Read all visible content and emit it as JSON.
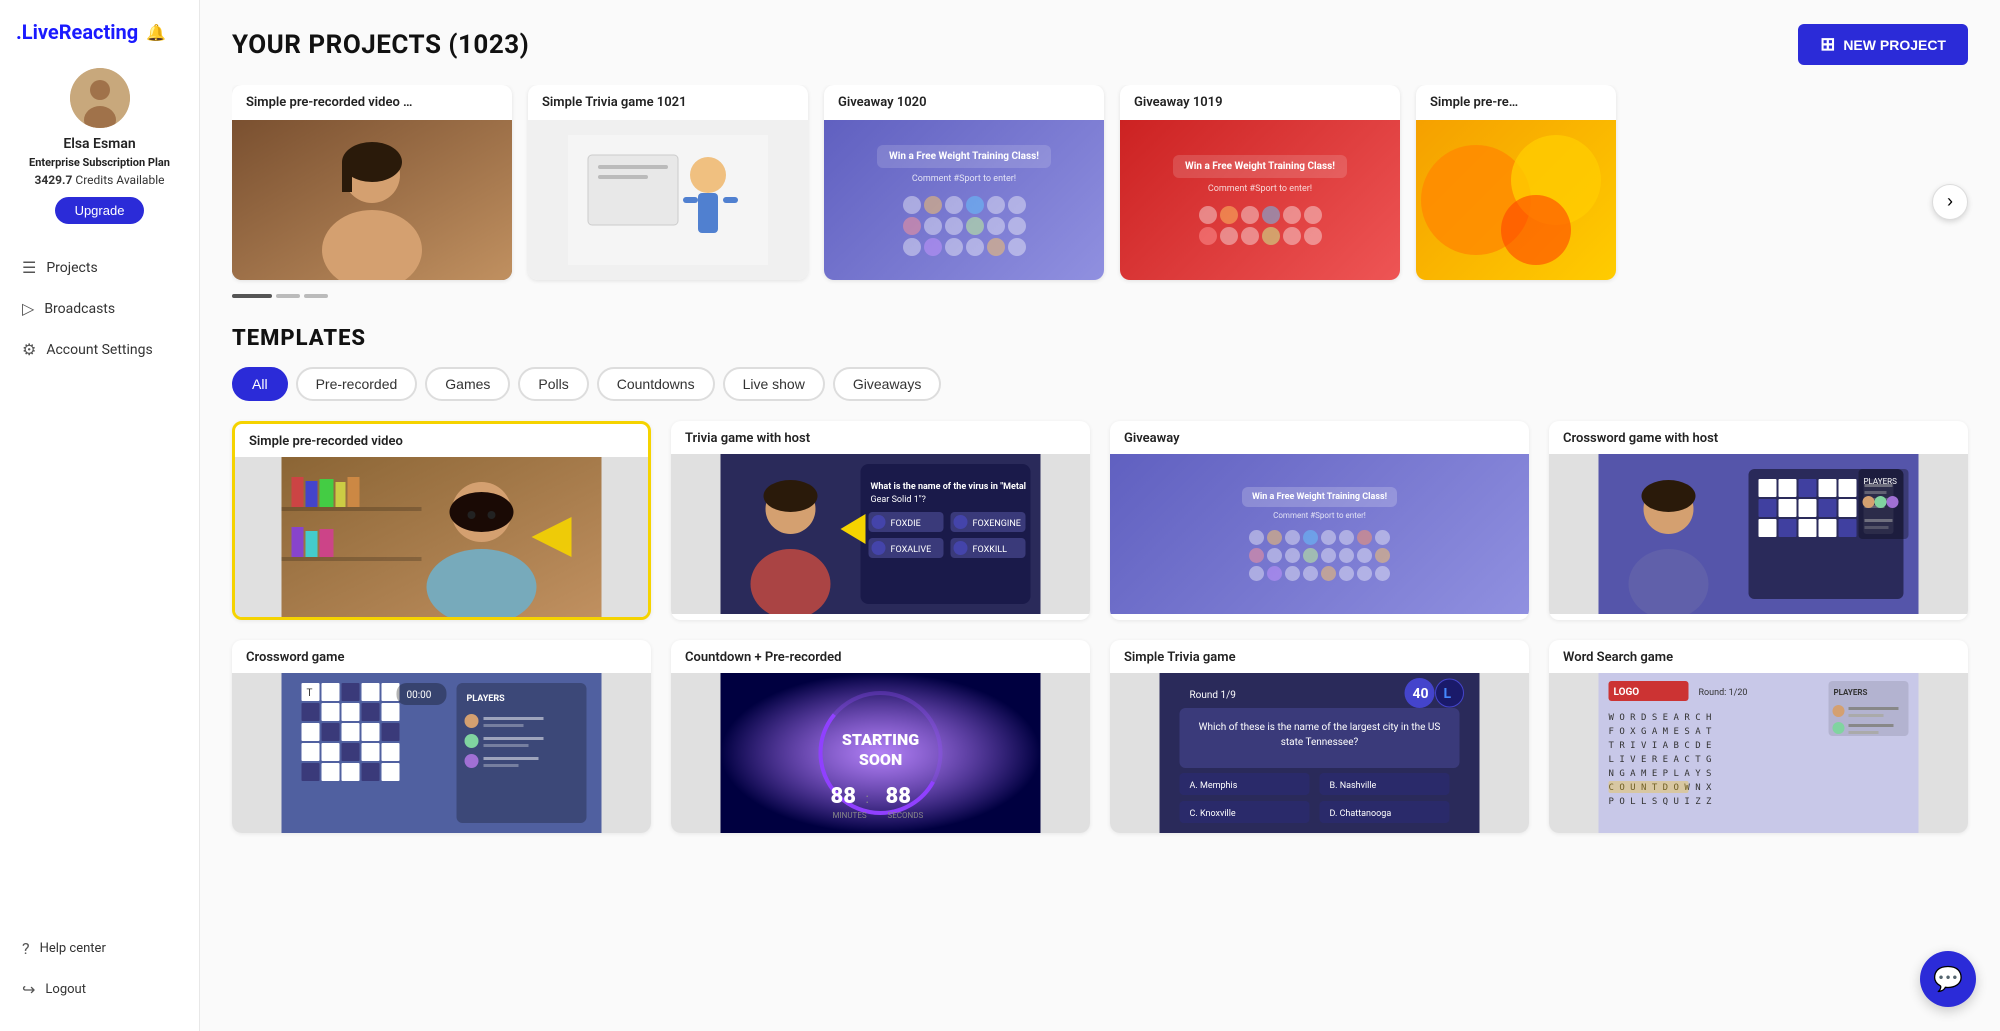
{
  "app": {
    "logo": ".LiveReacting",
    "notification_icon": "🔔"
  },
  "user": {
    "name": "Elsa Esman",
    "plan_type": "Enterprise",
    "plan_label": "Subscription Plan",
    "credits": "3429.7",
    "credits_label": "Credits Available",
    "upgrade_label": "Upgrade"
  },
  "sidebar": {
    "items": [
      {
        "id": "projects",
        "label": "Projects",
        "icon": "☰"
      },
      {
        "id": "broadcasts",
        "label": "Broadcasts",
        "icon": "▷"
      },
      {
        "id": "account-settings",
        "label": "Account Settings",
        "icon": "⚙"
      }
    ],
    "bottom_items": [
      {
        "id": "help",
        "label": "Help center",
        "icon": "?"
      },
      {
        "id": "logout",
        "label": "Logout",
        "icon": "↪"
      }
    ]
  },
  "header": {
    "title": "YOUR PROJECTS (1023)",
    "new_project_label": "NEW PROJECT",
    "plus_icon": "+"
  },
  "projects": [
    {
      "id": 1,
      "title": "Simple pre-recorded video …",
      "img_type": "woman"
    },
    {
      "id": 2,
      "title": "Simple Trivia game 1021",
      "img_type": "trivia_simple"
    },
    {
      "id": 3,
      "title": "Giveaway 1020",
      "img_type": "giveaway"
    },
    {
      "id": 4,
      "title": "Giveaway 1019",
      "img_type": "giveaway_red"
    },
    {
      "id": 5,
      "title": "Simple pre-re…",
      "img_type": "fruit"
    }
  ],
  "templates_section": {
    "title": "TEMPLATES",
    "filters": [
      {
        "id": "all",
        "label": "All",
        "active": true
      },
      {
        "id": "pre-recorded",
        "label": "Pre-recorded",
        "active": false
      },
      {
        "id": "games",
        "label": "Games",
        "active": false
      },
      {
        "id": "polls",
        "label": "Polls",
        "active": false
      },
      {
        "id": "countdowns",
        "label": "Countdowns",
        "active": false
      },
      {
        "id": "live-show",
        "label": "Live show",
        "active": false
      },
      {
        "id": "giveaways",
        "label": "Giveaways",
        "active": false
      }
    ],
    "templates": [
      {
        "id": 1,
        "title": "Simple pre-recorded video",
        "img_type": "woman_bookshelf",
        "selected": true
      },
      {
        "id": 2,
        "title": "Trivia game with host",
        "img_type": "trivia_host"
      },
      {
        "id": 3,
        "title": "Giveaway",
        "img_type": "giveaway_tmpl"
      },
      {
        "id": 4,
        "title": "Crossword game with host",
        "img_type": "crossword_host"
      },
      {
        "id": 5,
        "title": "Crossword game",
        "img_type": "crossword_game"
      },
      {
        "id": 6,
        "title": "Countdown + Pre-recorded",
        "img_type": "countdown"
      },
      {
        "id": 7,
        "title": "Simple Trivia game",
        "img_type": "trivia_simple_tmpl"
      },
      {
        "id": 8,
        "title": "Word Search game",
        "img_type": "word_search"
      }
    ]
  },
  "chat_icon": "💬"
}
